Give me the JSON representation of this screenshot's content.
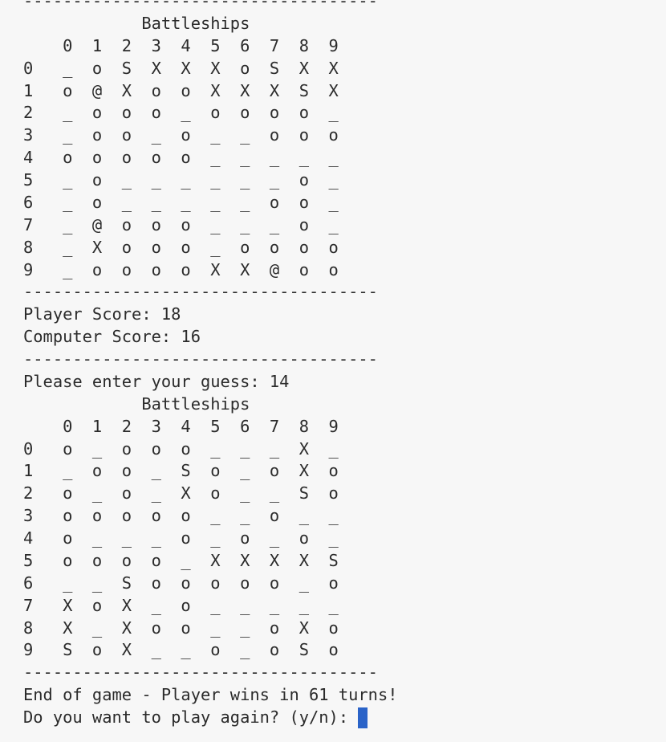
{
  "terminal": {
    "lines": [
      "------------------------------------",
      "            Battleships",
      "    0  1  2  3  4  5  6  7  8  9",
      "0   _  o  S  X  X  X  o  S  X  X",
      "1   o  @  X  o  o  X  X  X  S  X",
      "2   _  o  o  o  _  o  o  o  o  _",
      "3   _  o  o  _  o  _  _  o  o  o",
      "4   o  o  o  o  o  _  _  _  _  _",
      "5   _  o  _  _  _  _  _  _  o  _",
      "6   _  o  _  _  _  _  _  o  o  _",
      "7   _  @  o  o  o  _  _  _  o  _",
      "8   _  X  o  o  o  _  o  o  o  o",
      "9   _  o  o  o  o  X  X  @  o  o",
      "------------------------------------",
      "Player Score: 18",
      "Computer Score: 16",
      "------------------------------------",
      "Please enter your guess: 14",
      "            Battleships",
      "    0  1  2  3  4  5  6  7  8  9",
      "0   o  _  o  o  o  _  _  _  X  _",
      "1   _  o  o  _  S  o  _  o  X  o",
      "2   o  _  o  _  X  o  _  _  S  o",
      "3   o  o  o  o  o  _  _  o  _  _",
      "4   o  _  _  _  o  _  o  _  o  _",
      "5   o  o  o  o  _  X  X  X  X  S",
      "6   _  _  S  o  o  o  o  o  _  o",
      "7   X  o  X  _  o  _  _  _  _  _",
      "8   X  _  X  o  o  _  _  o  X  o",
      "9   S  o  X  _  _  o  _  o  S  o",
      "------------------------------------",
      "End of game - Player wins in 61 turns!"
    ],
    "prompt": "Do you want to play again? (y/n): "
  },
  "colors": {
    "background": "#f7f7f7",
    "text": "#2b2b2b",
    "cursor": "#2a63c8"
  }
}
